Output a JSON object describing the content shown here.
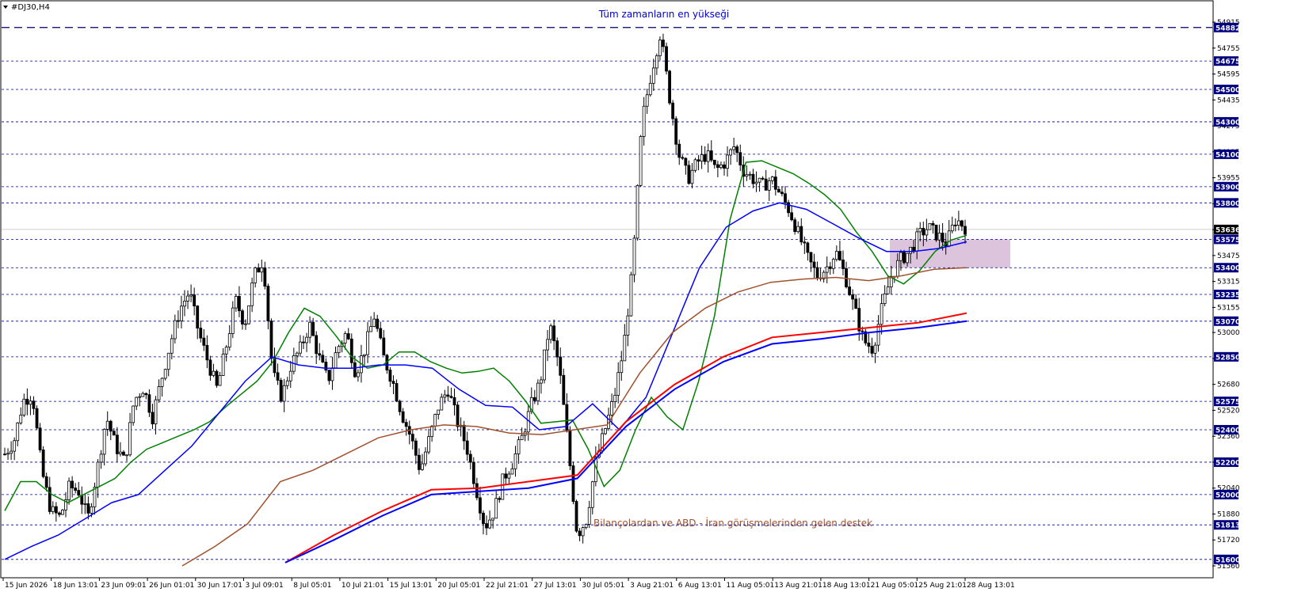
{
  "window": {
    "symbol_title": "#DJ30,H4",
    "menu_icon": "triangle-down-icon"
  },
  "chart_data": {
    "type": "candlestick",
    "symbol": "#DJ30",
    "timeframe": "H4",
    "ylim": [
      51560,
      54915
    ],
    "grid": false,
    "annotations": {
      "all_time_high": "Tüm zamanların en yükseği",
      "support_note": "Bilançolardan ve ABD - İran görüşmelerinden gelen destek"
    },
    "all_time_high_level": 54882,
    "horizontal_levels": [
      54882,
      54675,
      54500,
      54300,
      54100,
      53900,
      53800,
      53575,
      53400,
      53235,
      53070,
      52850,
      52575,
      52400,
      52200,
      52000,
      51813,
      51600
    ],
    "current_price": 53636,
    "price_ticks": [
      54915,
      54755,
      54595,
      54435,
      54275,
      54115,
      53955,
      53795,
      53635,
      53475,
      53315,
      53155,
      53000,
      52840,
      52680,
      52520,
      52360,
      52200,
      52040,
      51880,
      51720,
      51560
    ],
    "time_labels": [
      "15 Jun 2026",
      "18 Jun 13:01",
      "23 Jun 09:01",
      "26 Jun 01:01",
      "30 Jun 17:01",
      "3 Jul 09:01",
      "8 Jul 05:01",
      "10 Jul 21:01",
      "15 Jul 13:01",
      "20 Jul 05:01",
      "22 Jul 21:01",
      "27 Jul 13:01",
      "30 Jul 05:01",
      "3 Aug 21:01",
      "6 Aug 13:01",
      "11 Aug 05:01",
      "13 Aug 21:01",
      "18 Aug 13:01",
      "21 Aug 05:01",
      "25 Aug 21:01",
      "28 Aug 13:01"
    ],
    "close_path": [
      52250,
      52330,
      52580,
      52620,
      52150,
      51900,
      51860,
      52050,
      52020,
      51850,
      52150,
      52480,
      52300,
      52200,
      52580,
      52660,
      52480,
      52720,
      52950,
      53150,
      53250,
      53000,
      52820,
      52650,
      52920,
      53200,
      53050,
      53350,
      53450,
      52750,
      52600,
      52800,
      52900,
      53050,
      52850,
      52700,
      52900,
      53000,
      52750,
      52900,
      53100,
      52850,
      52700,
      52500,
      52350,
      52150,
      52350,
      52550,
      52650,
      52450,
      52300,
      52050,
      51800,
      51900,
      52100,
      52200,
      52350,
      52550,
      52700,
      53050,
      52800,
      52300,
      51750,
      51850,
      52200,
      52400,
      52600,
      52900,
      53400,
      54300,
      54600,
      54850,
      54450,
      54100,
      53950,
      54050,
      54100,
      54000,
      54050,
      54150,
      54000,
      53950,
      53900,
      53950,
      53850,
      53750,
      53600,
      53450,
      53350,
      53400,
      53500,
      53350,
      53150,
      52950,
      52900,
      53150,
      53350,
      53450,
      53500,
      53600,
      53650,
      53600,
      53550,
      53700,
      53650
    ],
    "series": [
      {
        "name": "",
        "color": "#008000",
        "values": [
          51900,
          52080,
          52080,
          52000,
          51950,
          52000,
          52050,
          52100,
          52200,
          52280,
          52320,
          52360,
          52400,
          52450,
          52540,
          52620,
          52700,
          52820,
          53000,
          53150,
          53100,
          52980,
          52850,
          52780,
          52800,
          52880,
          52880,
          52820,
          52780,
          52750,
          52760,
          52780,
          52700,
          52580,
          52440,
          52450,
          52460,
          52280,
          52050,
          52150,
          52400,
          52600,
          52480,
          52400,
          52700,
          53100,
          53700,
          54050,
          54060,
          54020,
          53980,
          53920,
          53850,
          53760,
          53620,
          53500,
          53350,
          53300,
          53380,
          53500,
          53570,
          53600
        ]
      },
      {
        "name": "",
        "color": "#0000ff",
        "values": [
          51600,
          51680,
          51750,
          51850,
          51950,
          52000,
          52150,
          52300,
          52500,
          52700,
          52850,
          52800,
          52780,
          52780,
          52800,
          52800,
          52780,
          52650,
          52550,
          52540,
          52400,
          52420,
          52560,
          52400,
          52600,
          53000,
          53400,
          53650,
          53750,
          53800,
          53760,
          53670,
          53580,
          53500,
          53500,
          53520,
          53560
        ]
      },
      {
        "name": "",
        "color": "#a0522d",
        "values": [
          51560,
          51680,
          51820,
          52080,
          52150,
          52250,
          52350,
          52400,
          52430,
          52420,
          52380,
          52370,
          52400,
          52430,
          52750,
          53000,
          53150,
          53250,
          53310,
          53330,
          53340,
          53320,
          53350,
          53390,
          53400
        ]
      },
      {
        "name": "",
        "color": "#ff0000",
        "values": [
          51580,
          51750,
          51900,
          52030,
          52040,
          52080,
          52120,
          52450,
          52680,
          52850,
          52970,
          53000,
          53030,
          53060,
          53120
        ]
      },
      {
        "name": "",
        "color": "#0000ff",
        "values": [
          51580,
          51720,
          51870,
          52000,
          52020,
          52040,
          52100,
          52420,
          52650,
          52820,
          52930,
          52960,
          53000,
          53030,
          53070
        ]
      }
    ],
    "zone": {
      "from": 53400,
      "to": 53575,
      "color": "#d8bfd8"
    }
  }
}
